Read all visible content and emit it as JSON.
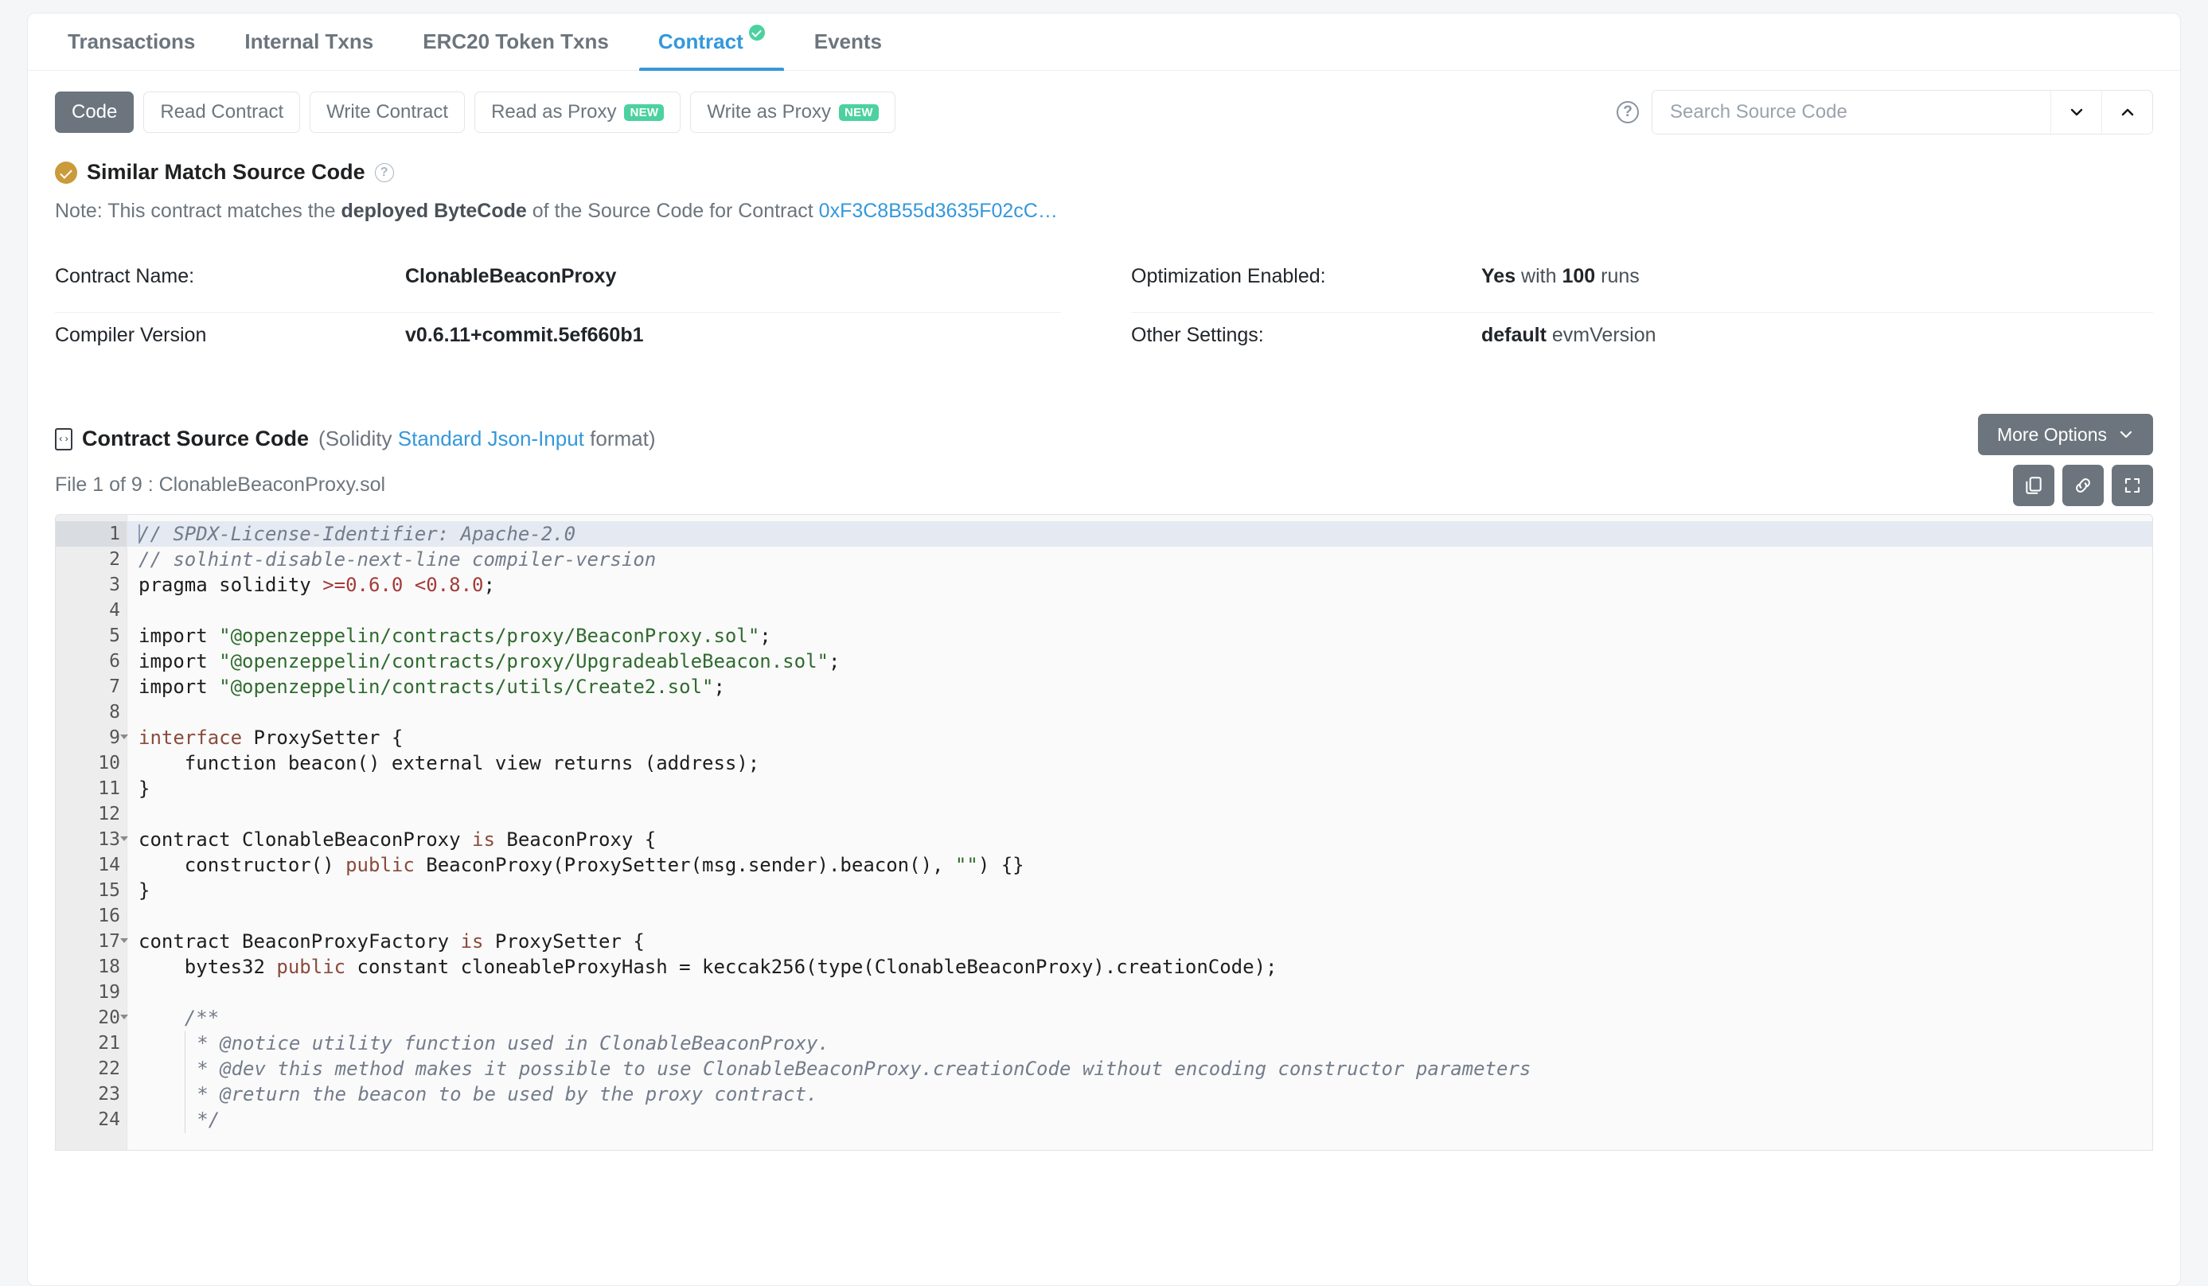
{
  "tabs": [
    {
      "label": "Transactions",
      "active": false,
      "verified": false
    },
    {
      "label": "Internal Txns",
      "active": false,
      "verified": false
    },
    {
      "label": "ERC20 Token Txns",
      "active": false,
      "verified": false
    },
    {
      "label": "Contract",
      "active": true,
      "verified": true
    },
    {
      "label": "Events",
      "active": false,
      "verified": false
    }
  ],
  "toolbar": {
    "buttons": [
      {
        "label": "Code",
        "primary": true,
        "badge": ""
      },
      {
        "label": "Read Contract",
        "primary": false,
        "badge": ""
      },
      {
        "label": "Write Contract",
        "primary": false,
        "badge": ""
      },
      {
        "label": "Read as Proxy",
        "primary": false,
        "badge": "NEW"
      },
      {
        "label": "Write as Proxy",
        "primary": false,
        "badge": "NEW"
      }
    ],
    "help_icon": "?",
    "search_placeholder": "Search Source Code",
    "search_value": "",
    "down_icon": "chevron-down-icon",
    "up_icon": "chevron-up-icon"
  },
  "similar_match": {
    "title": "Similar Match Source Code",
    "help_icon": "?",
    "note_prefix": "Note: This contract matches the ",
    "note_bold": "deployed ByteCode",
    "note_middle": " of the Source Code for Contract ",
    "note_link": "0xF3C8B55d3635F02cC…",
    "warning_icon": "warning-triangle-icon"
  },
  "details": {
    "left": [
      {
        "label": "Contract Name:",
        "value": "ClonableBeaconProxy",
        "value_suffix": ""
      },
      {
        "label": "Compiler Version",
        "value": "v0.6.11+commit.5ef660b1",
        "value_suffix": ""
      }
    ],
    "right": [
      {
        "label": "Optimization Enabled:",
        "value": "Yes",
        "value_mid": " with ",
        "value2": "100",
        "value_suffix": " runs"
      },
      {
        "label": "Other Settings:",
        "value": "default",
        "value_mid": " ",
        "value2": "",
        "value_suffix": "evmVersion"
      }
    ]
  },
  "source": {
    "title": "Contract Source Code",
    "sub_open": "(Solidity ",
    "sub_link": "Standard Json-Input",
    "sub_close": " format)",
    "file_label": "File 1 of 9 : ClonableBeaconProxy.sol",
    "more_options": "More Options",
    "icons": [
      "copy-icon",
      "link-icon",
      "fullscreen-icon"
    ]
  },
  "code_lines": [
    {
      "n": 1,
      "fold": false,
      "active": true,
      "tokens": [
        {
          "t": "caret",
          "v": ""
        },
        {
          "t": "cm",
          "v": "// SPDX-License-Identifier: Apache-2.0"
        }
      ]
    },
    {
      "n": 2,
      "fold": false,
      "active": false,
      "tokens": [
        {
          "t": "cm",
          "v": "// solhint-disable-next-line compiler-version"
        }
      ]
    },
    {
      "n": 3,
      "fold": false,
      "active": false,
      "tokens": [
        {
          "t": "p",
          "v": "pragma solidity "
        },
        {
          "t": "num",
          "v": ">=0.6.0 <0.8.0"
        },
        {
          "t": "p",
          "v": ";"
        }
      ]
    },
    {
      "n": 4,
      "fold": false,
      "active": false,
      "tokens": []
    },
    {
      "n": 5,
      "fold": false,
      "active": false,
      "tokens": [
        {
          "t": "p",
          "v": "import "
        },
        {
          "t": "str",
          "v": "\"@openzeppelin/contracts/proxy/BeaconProxy.sol\""
        },
        {
          "t": "p",
          "v": ";"
        }
      ]
    },
    {
      "n": 6,
      "fold": false,
      "active": false,
      "tokens": [
        {
          "t": "p",
          "v": "import "
        },
        {
          "t": "str",
          "v": "\"@openzeppelin/contracts/proxy/UpgradeableBeacon.sol\""
        },
        {
          "t": "p",
          "v": ";"
        }
      ]
    },
    {
      "n": 7,
      "fold": false,
      "active": false,
      "tokens": [
        {
          "t": "p",
          "v": "import "
        },
        {
          "t": "str",
          "v": "\"@openzeppelin/contracts/utils/Create2.sol\""
        },
        {
          "t": "p",
          "v": ";"
        }
      ]
    },
    {
      "n": 8,
      "fold": false,
      "active": false,
      "tokens": []
    },
    {
      "n": 9,
      "fold": true,
      "active": false,
      "tokens": [
        {
          "t": "kw",
          "v": "interface"
        },
        {
          "t": "p",
          "v": " ProxySetter {"
        }
      ]
    },
    {
      "n": 10,
      "fold": false,
      "active": false,
      "tokens": [
        {
          "t": "p",
          "v": "    function beacon() external view returns (address);"
        }
      ]
    },
    {
      "n": 11,
      "fold": false,
      "active": false,
      "tokens": [
        {
          "t": "p",
          "v": "}"
        }
      ]
    },
    {
      "n": 12,
      "fold": false,
      "active": false,
      "tokens": []
    },
    {
      "n": 13,
      "fold": true,
      "active": false,
      "tokens": [
        {
          "t": "p",
          "v": "contract ClonableBeaconProxy "
        },
        {
          "t": "kw",
          "v": "is"
        },
        {
          "t": "p",
          "v": " BeaconProxy {"
        }
      ]
    },
    {
      "n": 14,
      "fold": false,
      "active": false,
      "tokens": [
        {
          "t": "p",
          "v": "    constructor() "
        },
        {
          "t": "kw",
          "v": "public"
        },
        {
          "t": "p",
          "v": " BeaconProxy(ProxySetter(msg.sender).beacon(), "
        },
        {
          "t": "str",
          "v": "\"\""
        },
        {
          "t": "p",
          "v": ") {}"
        }
      ]
    },
    {
      "n": 15,
      "fold": false,
      "active": false,
      "tokens": [
        {
          "t": "p",
          "v": "}"
        }
      ]
    },
    {
      "n": 16,
      "fold": false,
      "active": false,
      "tokens": []
    },
    {
      "n": 17,
      "fold": true,
      "active": false,
      "tokens": [
        {
          "t": "p",
          "v": "contract BeaconProxyFactory "
        },
        {
          "t": "kw",
          "v": "is"
        },
        {
          "t": "p",
          "v": " ProxySetter {"
        }
      ]
    },
    {
      "n": 18,
      "fold": false,
      "active": false,
      "tokens": [
        {
          "t": "p",
          "v": "    bytes32 "
        },
        {
          "t": "kw",
          "v": "public"
        },
        {
          "t": "p",
          "v": " constant cloneableProxyHash = keccak256(type(ClonableBeaconProxy).creationCode);"
        }
      ]
    },
    {
      "n": 19,
      "fold": false,
      "active": false,
      "tokens": []
    },
    {
      "n": 20,
      "fold": true,
      "active": false,
      "tokens": [
        {
          "t": "p",
          "v": "    "
        },
        {
          "t": "cm",
          "v": "/**"
        }
      ]
    },
    {
      "n": 21,
      "fold": false,
      "active": false,
      "tokens": [
        {
          "t": "p",
          "v": "    "
        },
        {
          "t": "guide",
          "v": ""
        },
        {
          "t": "cm",
          "v": " * @notice utility function used in ClonableBeaconProxy."
        }
      ]
    },
    {
      "n": 22,
      "fold": false,
      "active": false,
      "tokens": [
        {
          "t": "p",
          "v": "    "
        },
        {
          "t": "guide",
          "v": ""
        },
        {
          "t": "cm",
          "v": " * @dev this method makes it possible to use ClonableBeaconProxy.creationCode without encoding constructor parameters"
        }
      ]
    },
    {
      "n": 23,
      "fold": false,
      "active": false,
      "tokens": [
        {
          "t": "p",
          "v": "    "
        },
        {
          "t": "guide",
          "v": ""
        },
        {
          "t": "cm",
          "v": " * @return the beacon to be used by the proxy contract."
        }
      ]
    },
    {
      "n": 24,
      "fold": false,
      "active": false,
      "tokens": [
        {
          "t": "p",
          "v": "    "
        },
        {
          "t": "guide",
          "v": ""
        },
        {
          "t": "cm",
          "v": " */"
        }
      ]
    }
  ],
  "colors": {
    "accent": "#3498db",
    "slate": "#6c757d",
    "green": "#4cd1a0",
    "gold": "#cb9a3b"
  }
}
